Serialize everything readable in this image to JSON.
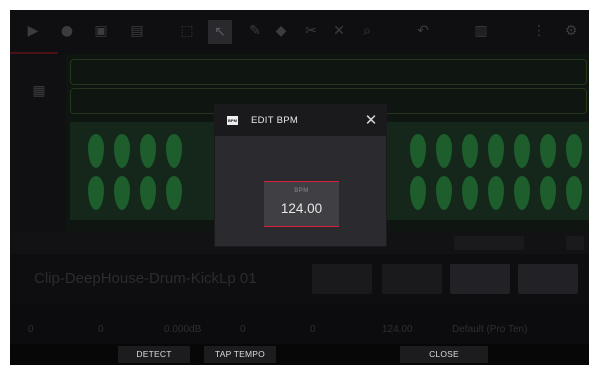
{
  "dialog": {
    "badge": "BPM",
    "title": "EDIT BPM",
    "close_glyph": "✕",
    "field_label": "BPM",
    "bpm_value": "124.00"
  },
  "bottom_bar": {
    "detect_label": "DETECT",
    "tap_tempo_label": "TAP TEMPO",
    "close_label": "CLOSE"
  },
  "background": {
    "sample_name": "Clip-DeepHouse-Drum-KickLp 01",
    "param_values": [
      "0",
      "0",
      "0.000dB",
      "0",
      "0",
      "124.00",
      "Default (Pro Ten)"
    ]
  },
  "colors": {
    "accent_red": "#d3223a",
    "dialog_bg": "#2b2b2f",
    "waveform_green": "#1e5d2c"
  },
  "icons": [
    "play-icon",
    "record-icon",
    "pencil-icon",
    "select-icon",
    "zoom-icon",
    "settings-icon"
  ]
}
